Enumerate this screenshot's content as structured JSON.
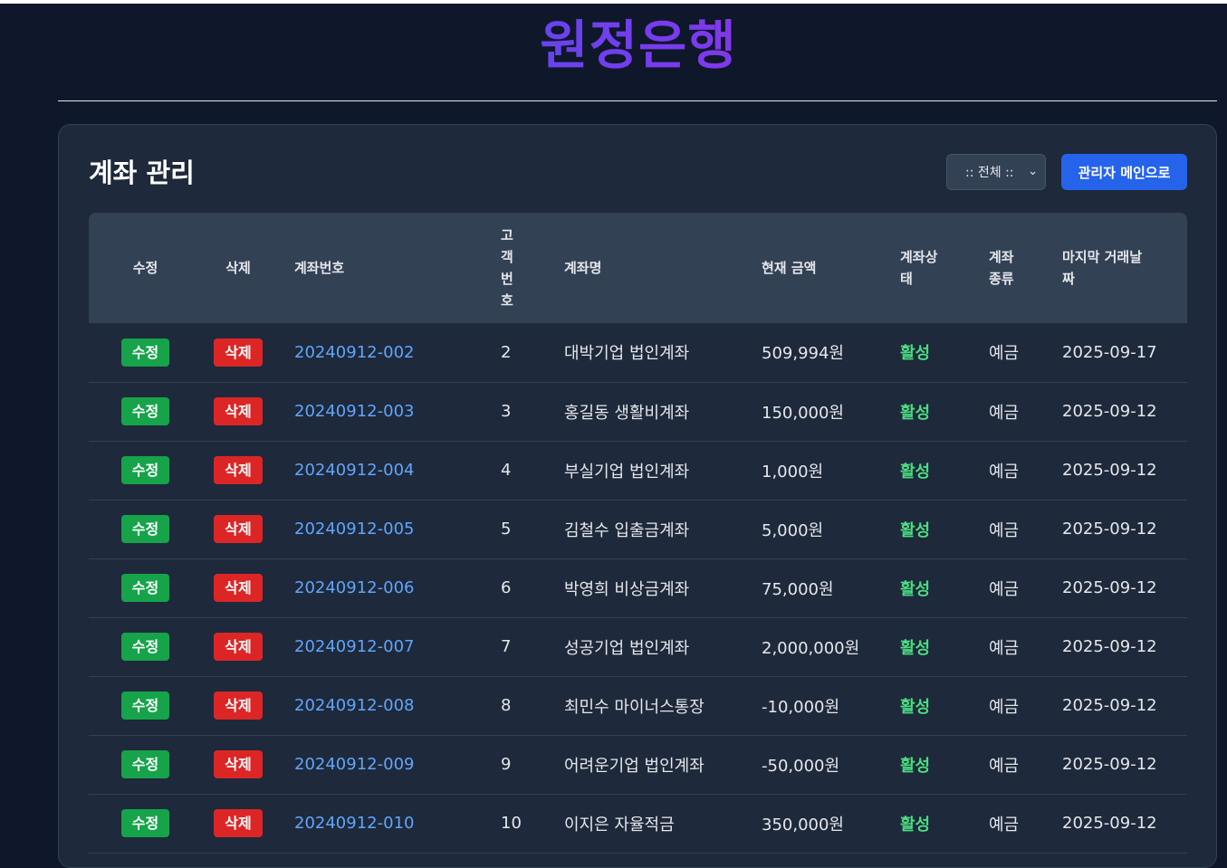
{
  "brand": "원정은행",
  "page_title": "계좌 관리",
  "filter": {
    "selected": ":: 전체 ::"
  },
  "admin_button": "관리자 메인으로",
  "table": {
    "headers": {
      "edit": "수정",
      "delete": "삭제",
      "account_no": "계좌번호",
      "customer_no": "고객번호",
      "account_name": "계좌명",
      "balance": "현재 금액",
      "status": "계좌상태",
      "type": "계좌종류",
      "last_date": "마지막 거래날짜"
    },
    "rows": [
      {
        "edit": "수정",
        "delete": "삭제",
        "account_no": "20240912-002",
        "customer_no": "2",
        "account_name": "대박기업 법인계좌",
        "balance": "509,994원",
        "status": "활성",
        "type": "예금",
        "last_date": "2025-09-17"
      },
      {
        "edit": "수정",
        "delete": "삭제",
        "account_no": "20240912-003",
        "customer_no": "3",
        "account_name": "홍길동 생활비계좌",
        "balance": "150,000원",
        "status": "활성",
        "type": "예금",
        "last_date": "2025-09-12"
      },
      {
        "edit": "수정",
        "delete": "삭제",
        "account_no": "20240912-004",
        "customer_no": "4",
        "account_name": "부실기업 법인계좌",
        "balance": "1,000원",
        "status": "활성",
        "type": "예금",
        "last_date": "2025-09-12"
      },
      {
        "edit": "수정",
        "delete": "삭제",
        "account_no": "20240912-005",
        "customer_no": "5",
        "account_name": "김철수 입출금계좌",
        "balance": "5,000원",
        "status": "활성",
        "type": "예금",
        "last_date": "2025-09-12"
      },
      {
        "edit": "수정",
        "delete": "삭제",
        "account_no": "20240912-006",
        "customer_no": "6",
        "account_name": "박영희 비상금계좌",
        "balance": "75,000원",
        "status": "활성",
        "type": "예금",
        "last_date": "2025-09-12"
      },
      {
        "edit": "수정",
        "delete": "삭제",
        "account_no": "20240912-007",
        "customer_no": "7",
        "account_name": "성공기업 법인계좌",
        "balance": "2,000,000원",
        "status": "활성",
        "type": "예금",
        "last_date": "2025-09-12"
      },
      {
        "edit": "수정",
        "delete": "삭제",
        "account_no": "20240912-008",
        "customer_no": "8",
        "account_name": "최민수 마이너스통장",
        "balance": "-10,000원",
        "status": "활성",
        "type": "예금",
        "last_date": "2025-09-12"
      },
      {
        "edit": "수정",
        "delete": "삭제",
        "account_no": "20240912-009",
        "customer_no": "9",
        "account_name": "어려운기업 법인계좌",
        "balance": "-50,000원",
        "status": "활성",
        "type": "예금",
        "last_date": "2025-09-12"
      },
      {
        "edit": "수정",
        "delete": "삭제",
        "account_no": "20240912-010",
        "customer_no": "10",
        "account_name": "이지은 자율적금",
        "balance": "350,000원",
        "status": "활성",
        "type": "예금",
        "last_date": "2025-09-12"
      }
    ]
  }
}
